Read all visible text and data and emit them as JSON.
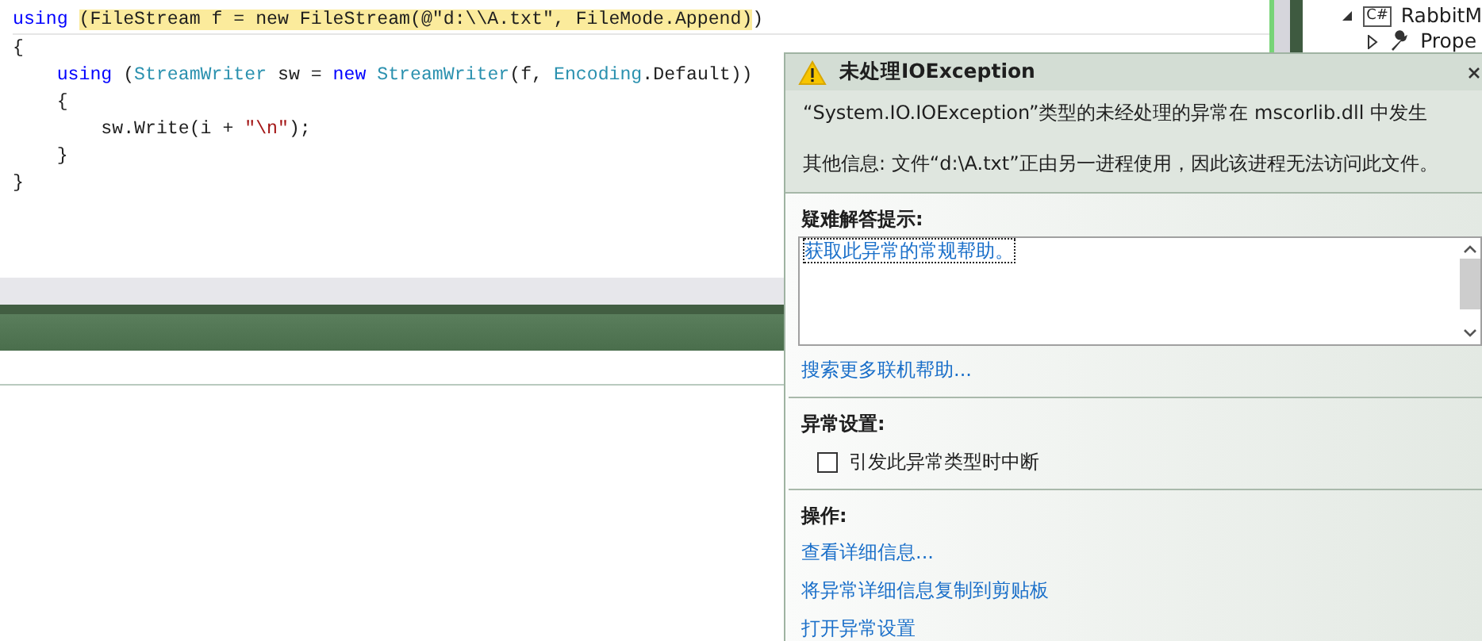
{
  "code_lines": [
    {
      "tokens": [
        {
          "text": "using ",
          "kind": "keyword",
          "highlighted": false
        },
        {
          "text": "(FileStream",
          "kind": "plain",
          "highlighted": true
        },
        {
          "text": " f = ",
          "kind": "plain",
          "highlighted": true
        },
        {
          "text": "new",
          "kind": "plain",
          "highlighted": true
        },
        {
          "text": " FileStream(@\"d:\\\\A.txt\", FileMode.Append)",
          "kind": "plain",
          "highlighted": true
        },
        {
          "text": ")",
          "kind": "plain",
          "highlighted": false
        }
      ]
    },
    {
      "tokens": [
        {
          "text": "{",
          "kind": "plain",
          "highlighted": false
        }
      ]
    },
    {
      "tokens": [
        {
          "text": "    using",
          "kind": "keyword",
          "highlighted": false
        },
        {
          "text": " (",
          "kind": "plain",
          "highlighted": false
        },
        {
          "text": "StreamWriter",
          "kind": "type",
          "highlighted": false
        },
        {
          "text": " sw = ",
          "kind": "plain",
          "highlighted": false
        },
        {
          "text": "new ",
          "kind": "keyword",
          "highlighted": false
        },
        {
          "text": "StreamWriter",
          "kind": "type",
          "highlighted": false
        },
        {
          "text": "(f, ",
          "kind": "plain",
          "highlighted": false
        },
        {
          "text": "Encoding",
          "kind": "type",
          "highlighted": false
        },
        {
          "text": ".Default))",
          "kind": "plain",
          "highlighted": false
        }
      ]
    },
    {
      "tokens": [
        {
          "text": "    {",
          "kind": "plain",
          "highlighted": false
        }
      ]
    },
    {
      "tokens": [
        {
          "text": "        sw.Write(i + ",
          "kind": "plain",
          "highlighted": false
        },
        {
          "text": "\"\\n\"",
          "kind": "string",
          "highlighted": false
        },
        {
          "text": ");",
          "kind": "plain",
          "highlighted": false
        }
      ]
    },
    {
      "tokens": [
        {
          "text": "    }",
          "kind": "plain",
          "highlighted": false
        }
      ]
    },
    {
      "tokens": [
        {
          "text": "}",
          "kind": "plain",
          "highlighted": false
        }
      ]
    }
  ],
  "solution_explorer": {
    "items": [
      {
        "label": "RabbitM",
        "kind": "project",
        "badge": "C#",
        "expanded": true
      },
      {
        "label": "Prope",
        "kind": "properties",
        "expanded": false
      }
    ]
  },
  "exception_popup": {
    "title": "未处理IOException",
    "message": "“System.IO.IOException”类型的未经处理的异常在 mscorlib.dll 中发生",
    "details": "其他信息: 文件“d:\\A.txt”正由另一进程使用，因此该进程无法访问此文件。",
    "troubleshooting": {
      "heading": "疑难解答提示:",
      "tips": [
        {
          "text": "获取此异常的常规帮助。",
          "selected": true
        }
      ],
      "more_link": "搜索更多联机帮助..."
    },
    "settings": {
      "heading": "异常设置:",
      "checkbox": {
        "label": "引发此异常类型时中断",
        "checked": false
      }
    },
    "actions": {
      "heading": "操作:",
      "links": [
        "查看详细信息...",
        "将异常详细信息复制到剪贴板",
        "打开异常设置"
      ]
    }
  }
}
